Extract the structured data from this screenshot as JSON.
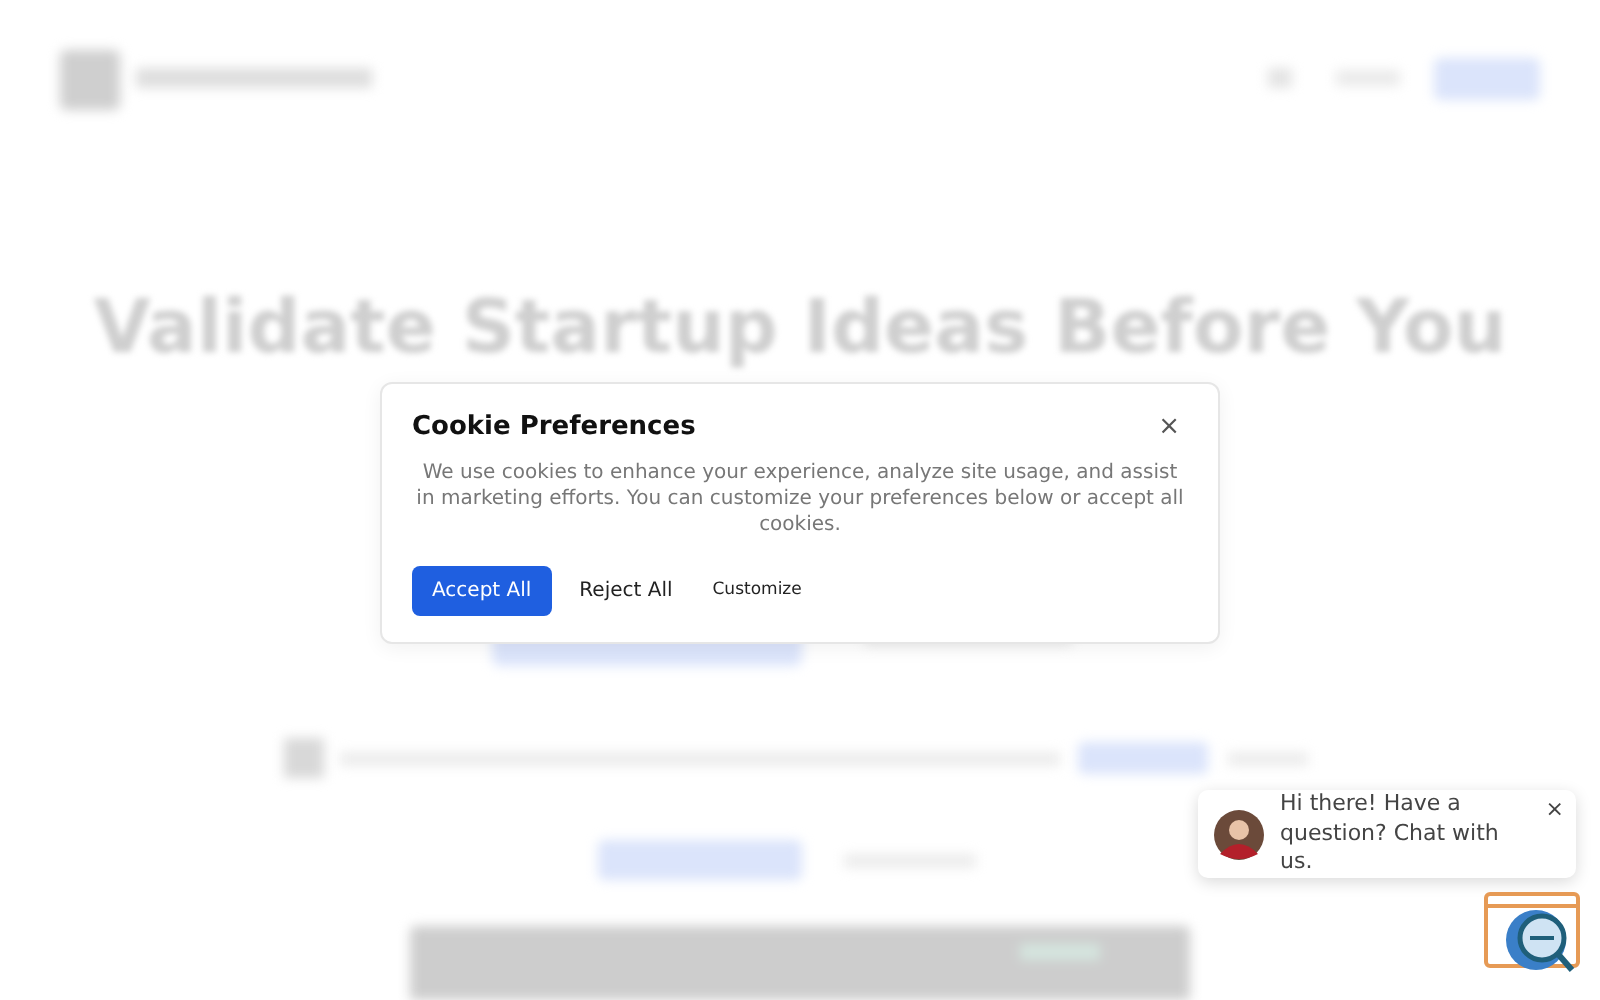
{
  "backdrop": {
    "headline": "Validate Startup Ideas Before You"
  },
  "cookie_dialog": {
    "title": "Cookie Preferences",
    "close": "×",
    "message": "We use cookies to enhance your experience, analyze site usage, and assist in marketing efforts. You can customize your preferences below or accept all cookies.",
    "buttons": [
      {
        "label": "Accept All",
        "kind": "primary"
      },
      {
        "label": "Reject All",
        "kind": "plain"
      },
      {
        "label": "Customize",
        "kind": "small"
      }
    ]
  },
  "chat_bubble": {
    "message": "Hi there! Have a question? Chat with us.",
    "close": "×"
  }
}
